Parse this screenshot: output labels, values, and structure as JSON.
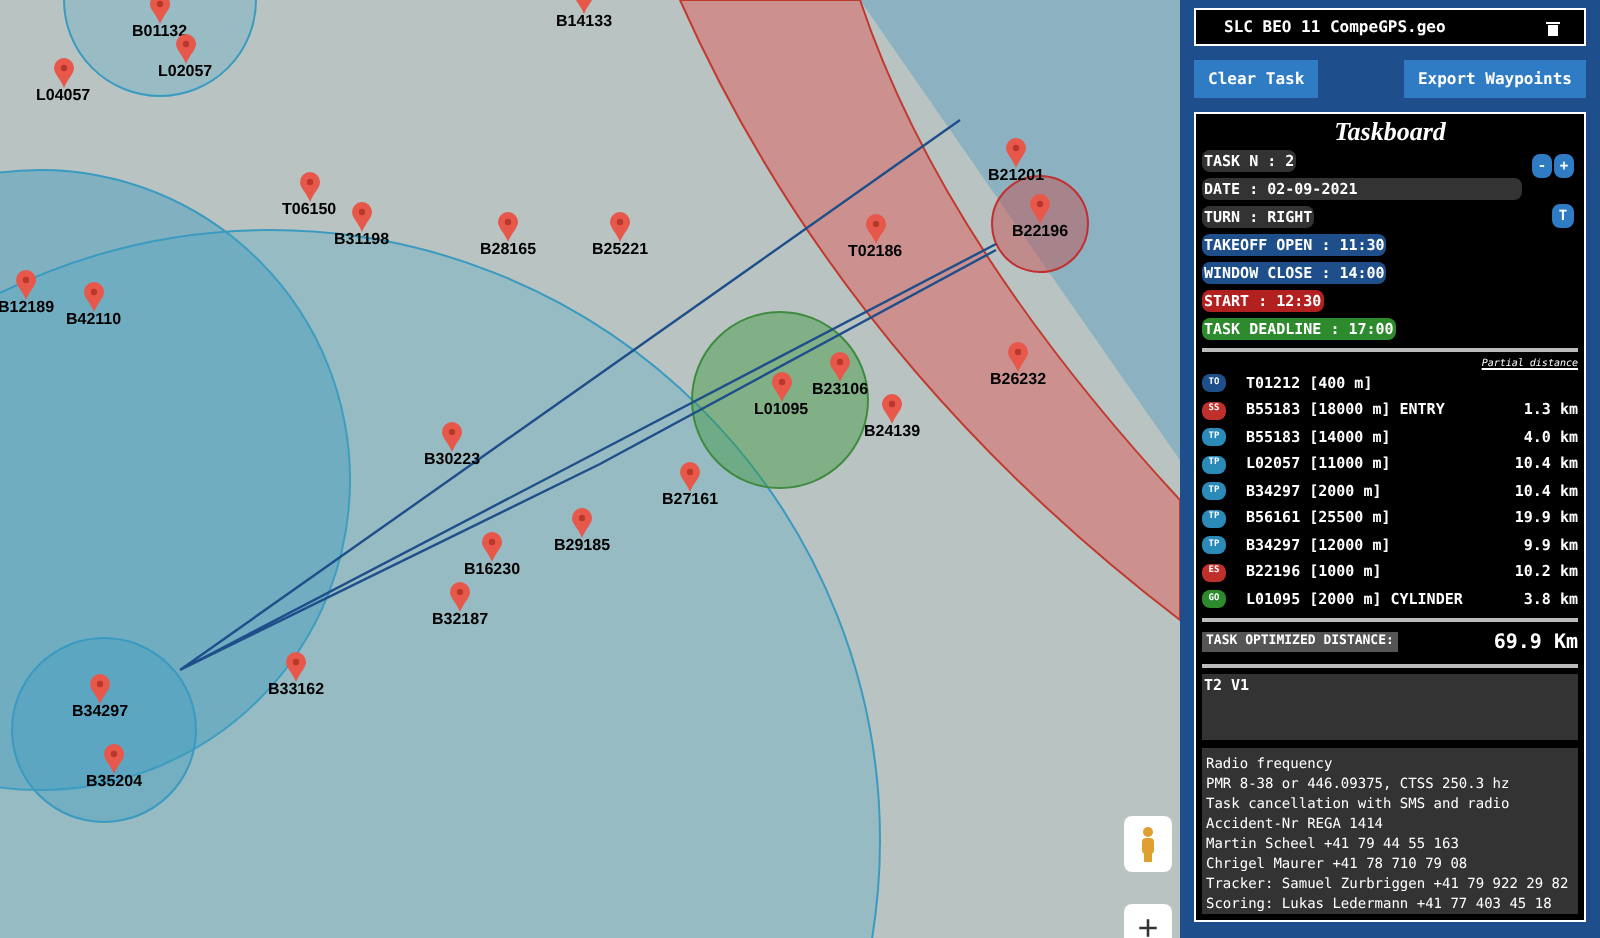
{
  "map": {
    "markers": [
      {
        "label": "B01132"
      },
      {
        "label": "L02057"
      },
      {
        "label": "L04057"
      },
      {
        "label": "B14133"
      },
      {
        "label": "T06150"
      },
      {
        "label": "B31198"
      },
      {
        "label": "B28165"
      },
      {
        "label": "B25221"
      },
      {
        "label": "B12189"
      },
      {
        "label": "B42110"
      },
      {
        "label": "B30223"
      },
      {
        "label": "B27161"
      },
      {
        "label": "B29185"
      },
      {
        "label": "B16230"
      },
      {
        "label": "B32187"
      },
      {
        "label": "B34297"
      },
      {
        "label": "B33162"
      },
      {
        "label": "B35204"
      },
      {
        "label": "B21201"
      },
      {
        "label": "B22196"
      },
      {
        "label": "T02186"
      },
      {
        "label": "B23106"
      },
      {
        "label": "L01095"
      },
      {
        "label": "B24139"
      },
      {
        "label": "B26232"
      }
    ],
    "zoom_in": "+"
  },
  "panel": {
    "file": {
      "name": "SLC BEO 11 CompeGPS.geo"
    },
    "buttons": [
      "Clear Task",
      "Export Waypoints"
    ],
    "taskboard": {
      "title": "Taskboard",
      "fields": [
        {
          "text": "TASK N : 2",
          "kind": "plain"
        },
        {
          "text": "DATE : 02-09-2021",
          "kind": "wide"
        },
        {
          "text": "TURN : RIGHT",
          "kind": "plain"
        },
        {
          "text": "TAKEOFF OPEN : 11:30",
          "kind": "blue"
        },
        {
          "text": "WINDOW CLOSE : 14:00",
          "kind": "blue"
        },
        {
          "text": "START : 12:30",
          "kind": "red"
        },
        {
          "text": "TASK DEADLINE : 17:00",
          "kind": "green"
        }
      ],
      "task_buttons": [
        "-",
        "+"
      ],
      "turn_button": "T",
      "partial_heading": "Partial distance",
      "turnpoints": [
        {
          "badge": "TO",
          "kind": "takeoff",
          "name": "T01212 [400 m]"
        },
        {
          "badge": "SS",
          "kind": "start",
          "name": "B55183 [18000 m] ENTRY",
          "distance": "1.3 km"
        },
        {
          "badge": "TP",
          "kind": "turnpoint",
          "name": "B55183 [14000 m]",
          "distance": "4.0 km"
        },
        {
          "badge": "TP",
          "kind": "turnpoint",
          "name": "L02057 [11000 m]",
          "distance": "10.4 km"
        },
        {
          "badge": "TP",
          "kind": "turnpoint",
          "name": "B34297 [2000 m]",
          "distance": "10.4 km"
        },
        {
          "badge": "TP",
          "kind": "turnpoint",
          "name": "B56161 [25500 m]",
          "distance": "19.9 km"
        },
        {
          "badge": "TP",
          "kind": "turnpoint",
          "name": "B34297 [12000 m]",
          "distance": "9.9 km"
        },
        {
          "badge": "ES",
          "kind": "end",
          "name": "B22196 [1000 m]",
          "distance": "10.2 km"
        },
        {
          "badge": "GO",
          "kind": "goal",
          "name": "L01095 [2000 m] CYLINDER",
          "distance": "3.8 km"
        }
      ],
      "optimized_label": "TASK OPTIMIZED DISTANCE:",
      "optimized_value": "69.9 Km",
      "task_name": "T2 V1",
      "notes": [
        "Radio frequency",
        "PMR 8-38 or 446.09375, CTSS 250.3 hz",
        "Task cancellation with SMS and radio",
        "Accident-Nr REGA 1414",
        "Martin Scheel +41 79 44 55 163",
        "Chrigel Maurer +41 78 710 79 08",
        "Tracker: Samuel Zurbriggen +41 79 922 29 82",
        "Scoring: Lukas Ledermann +41 77 403 45 18"
      ]
    }
  }
}
